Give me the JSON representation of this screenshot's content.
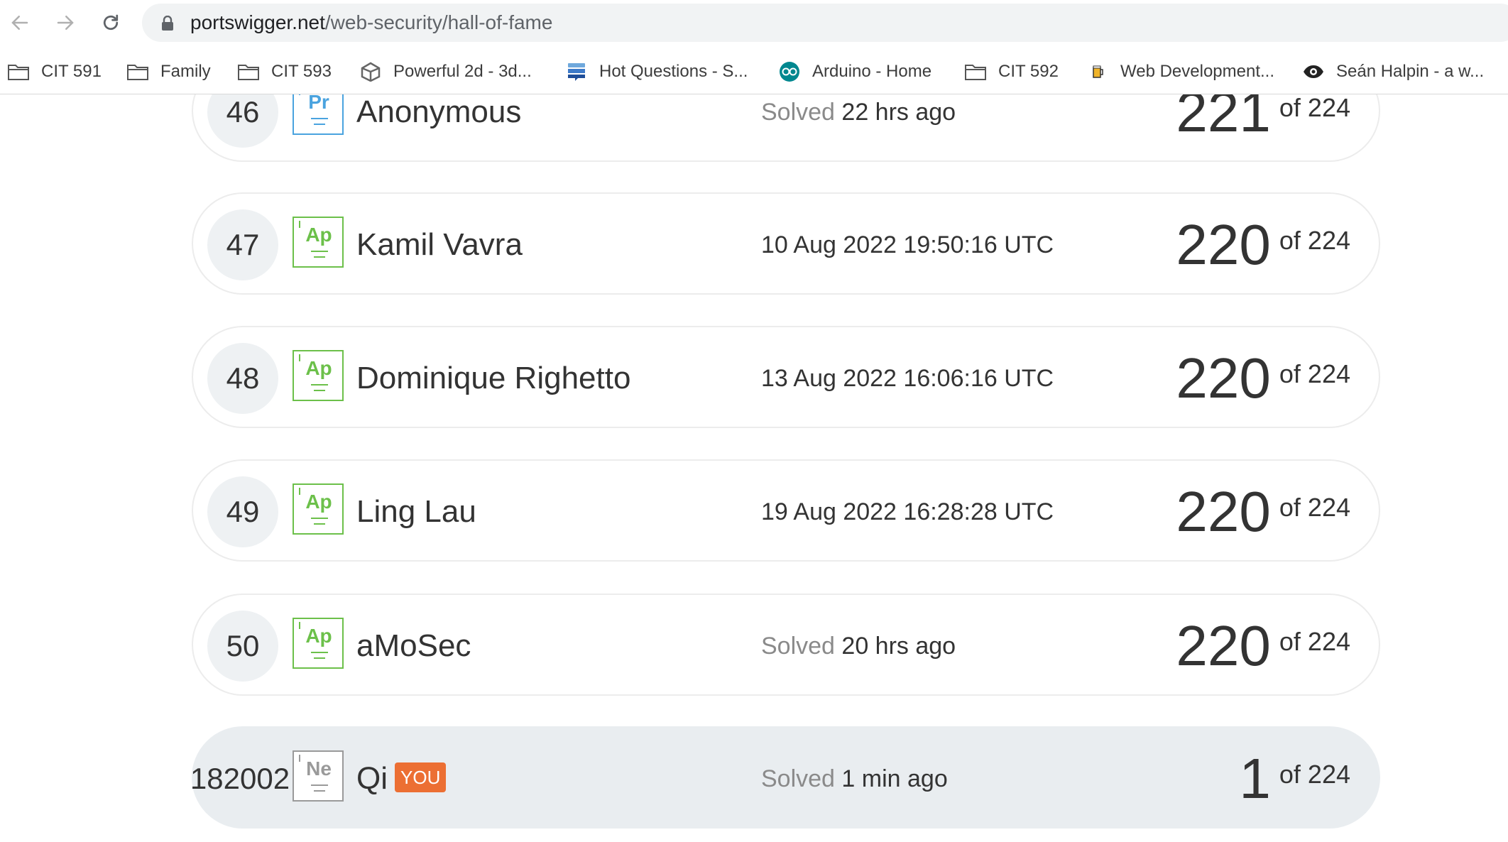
{
  "browser": {
    "url_host": "portswigger.net",
    "url_path": "/web-security/hall-of-fame",
    "bookmarks": [
      {
        "label": "CIT 591",
        "icon": "folder-icon"
      },
      {
        "label": "Family",
        "icon": "folder-icon"
      },
      {
        "label": "CIT 593",
        "icon": "folder-icon"
      },
      {
        "label": "Powerful 2d - 3d...",
        "icon": "unity-icon"
      },
      {
        "label": "Hot Questions - S...",
        "icon": "stack-exchange-icon"
      },
      {
        "label": "Arduino - Home",
        "icon": "arduino-icon"
      },
      {
        "label": "CIT 592",
        "icon": "folder-icon"
      },
      {
        "label": "Web Development...",
        "icon": "beer-icon"
      },
      {
        "label": "Seán Halpin - a w...",
        "icon": "eye-icon"
      }
    ]
  },
  "leaderboard": {
    "rows": [
      {
        "rank": "46",
        "badge": "Pr",
        "name": "Anonymous",
        "date_label": "Solved",
        "date": "22 hrs ago",
        "score": "221",
        "total": "of 224"
      },
      {
        "rank": "47",
        "badge": "Ap",
        "name": "Kamil Vavra",
        "date_label": "",
        "date": "10 Aug 2022 19:50:16 UTC",
        "score": "220",
        "total": "of 224"
      },
      {
        "rank": "48",
        "badge": "Ap",
        "name": "Dominique Righetto",
        "date_label": "",
        "date": "13 Aug 2022 16:06:16 UTC",
        "score": "220",
        "total": "of 224"
      },
      {
        "rank": "49",
        "badge": "Ap",
        "name": "Ling Lau",
        "date_label": "",
        "date": "19 Aug 2022 16:28:28 UTC",
        "score": "220",
        "total": "of 224"
      },
      {
        "rank": "50",
        "badge": "Ap",
        "name": "aMoSec",
        "date_label": "Solved",
        "date": "20 hrs ago",
        "score": "220",
        "total": "of 224"
      }
    ],
    "me": {
      "rank": "182002",
      "badge": "Ne",
      "name": "Qi",
      "you_label": "YOU",
      "date_label": "Solved",
      "date": "1 min ago",
      "score": "1",
      "total": "of 224"
    }
  }
}
